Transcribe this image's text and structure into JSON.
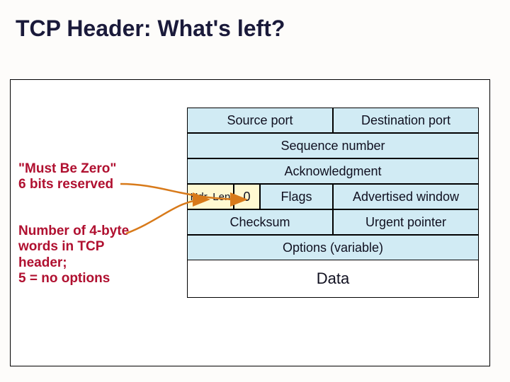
{
  "title": "TCP Header: What's left?",
  "annot": {
    "zero": "\"Must Be Zero\"\n6 bits reserved",
    "hdrlen": "Number of 4-byte\nwords in TCP\nheader;\n5 = no options"
  },
  "hdr": {
    "srcport": "Source port",
    "dstport": "Destination port",
    "seq": "Sequence number",
    "ack": "Acknowledgment",
    "hdrlen": "Hdr. Len",
    "zero": "0",
    "flags": "Flags",
    "advwin": "Advertised window",
    "cksum": "Checksum",
    "urg": "Urgent pointer",
    "opts": "Options (variable)",
    "data": "Data"
  }
}
